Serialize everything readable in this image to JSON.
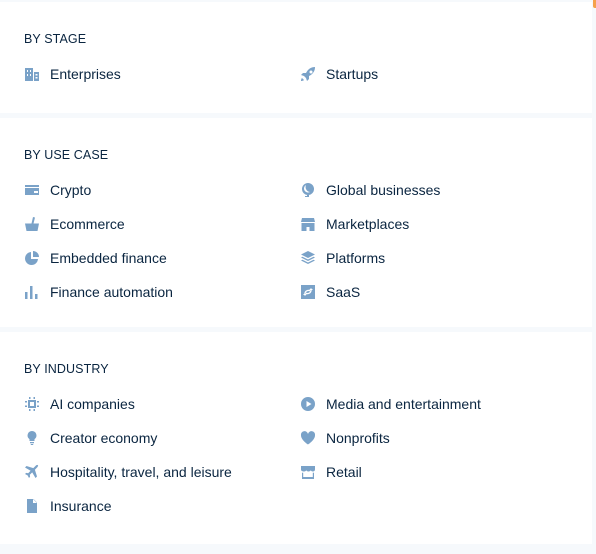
{
  "colors": {
    "icon": "#7aa2c8",
    "text": "#0a2540",
    "panel": "#ffffff",
    "background": "#f6f9fc"
  },
  "sections": [
    {
      "heading": "BY STAGE",
      "items": [
        {
          "label": "Enterprises",
          "icon": "building-icon"
        },
        {
          "label": "Startups",
          "icon": "rocket-icon"
        }
      ]
    },
    {
      "heading": "BY USE CASE",
      "items": [
        {
          "label": "Crypto",
          "icon": "wallet-icon"
        },
        {
          "label": "Global businesses",
          "icon": "globe-icon"
        },
        {
          "label": "Ecommerce",
          "icon": "basket-icon"
        },
        {
          "label": "Marketplaces",
          "icon": "storefront-icon"
        },
        {
          "label": "Embedded finance",
          "icon": "pie-chart-icon"
        },
        {
          "label": "Platforms",
          "icon": "layers-icon"
        },
        {
          "label": "Finance automation",
          "icon": "bar-chart-icon"
        },
        {
          "label": "SaaS",
          "icon": "recurring-icon"
        }
      ]
    },
    {
      "heading": "BY INDUSTRY",
      "items": [
        {
          "label": "AI companies",
          "icon": "chip-icon"
        },
        {
          "label": "Media and entertainment",
          "icon": "play-icon"
        },
        {
          "label": "Creator economy",
          "icon": "lightbulb-icon"
        },
        {
          "label": "Nonprofits",
          "icon": "heart-icon"
        },
        {
          "label": "Hospitality, travel, and leisure",
          "icon": "plane-icon"
        },
        {
          "label": "Retail",
          "icon": "shop-icon"
        },
        {
          "label": "Insurance",
          "icon": "document-icon"
        }
      ]
    }
  ]
}
